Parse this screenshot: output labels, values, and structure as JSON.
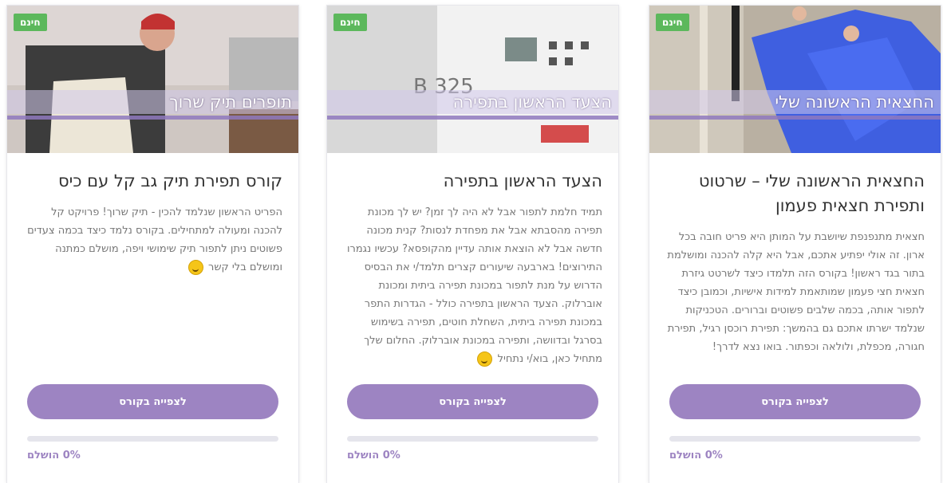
{
  "colors": {
    "accent": "#9d84c2",
    "free_badge": "#5cb85c"
  },
  "courses": [
    {
      "badge": "חינם",
      "thumb_caption": "החצאית הראשונה שלי",
      "title": "החצאית הראשונה שלי – שרטוט ותפירת חצאית פעמון",
      "description": "חצאית מתנפנפת שיושבת על המותן היא פריט חובה בכל ארון. זה אולי יפתיע אתכם, אבל היא קלה להכנה ומושלמת בתור בגד ראשון! בקורס הזה תלמדו כיצד לשרטט גיזרת חצאית חצי פעמון שמותאמת למידות אישיות, וכמובן כיצד לתפור אותה, בכמה שלבים פשוטים וברורים. הטכניקות שנלמד ישרתו אתכם גם בהמשך: תפירת רוכסן רגיל, תפירת חגורה, מכפלת, ולולאה וכפתור. בואו נצא לדרך!",
      "button_label": "לצפייה בקורס",
      "progress": 0,
      "progress_label": "0% הושלם"
    },
    {
      "badge": "חינם",
      "thumb_caption": "הצעד הראשון בתפירה",
      "title": "הצעד הראשון בתפירה",
      "description": "תמיד חלמת לתפור אבל לא היה לך זמן? יש לך מכונת תפירה מהסבתא אבל את מפחדת לנסות? קנית מכונה חדשה אבל לא הוצאת אותה עדיין מהקופסא? עכשיו נגמרו התירוצים! בארבעה שיעורים קצרים תלמד/י את הבסיס הדרוש על מנת לתפור במכונת תפירה ביתית ומכונת אוברלוק. הצעד הראשון בתפירה כולל - הגדרות התפר במכונת תפירה ביתית, השחלת חוטים, תפירה בשימוש בסרגל ובדוושה, ותפירה במכונת אוברלוק. החלום שלך מתחיל כאן, בוא/י נתחיל",
      "button_label": "לצפייה בקורס",
      "progress": 0,
      "progress_label": "0% הושלם"
    },
    {
      "badge": "חינם",
      "thumb_caption": "תופרים תיק שרוך",
      "title": "קורס תפירת תיק גב קל עם כיס",
      "description": "הפריט הראשון שנלמד להכין - תיק שרוך! פרויקט קל להכנה ומעולה למתחילים. בקורס נלמד כיצד בכמה צעדים פשוטים ניתן לתפור תיק שימושי ויפה, מושלם כמתנה ומושלם בלי קשר",
      "button_label": "לצפייה בקורס",
      "progress": 0,
      "progress_label": "0% הושלם"
    }
  ]
}
